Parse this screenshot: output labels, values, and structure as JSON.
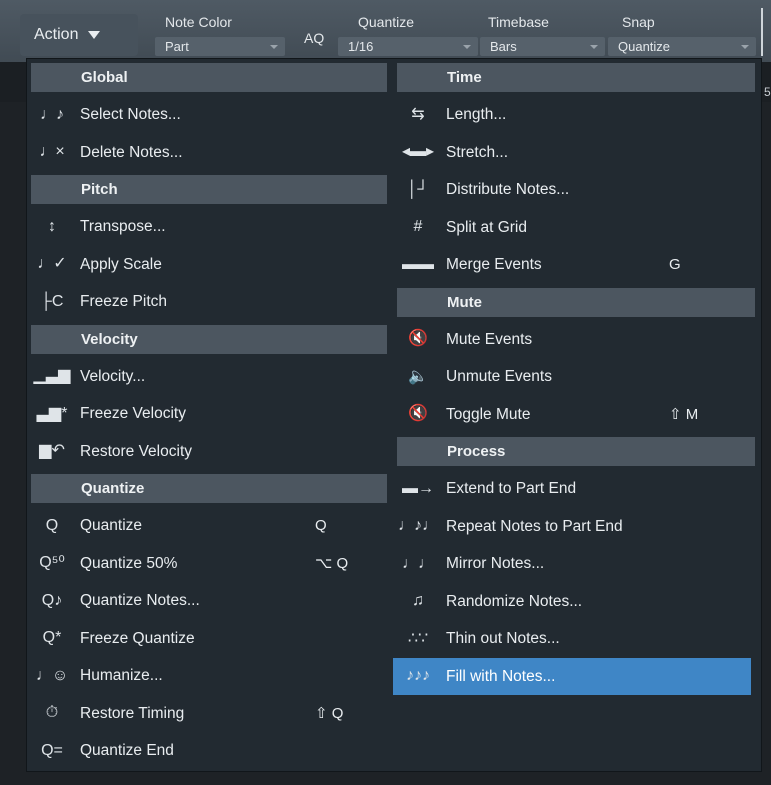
{
  "toolbar": {
    "action": "Action",
    "note_color": {
      "label": "Note Color",
      "value": "Part"
    },
    "aq": "AQ",
    "quantize": {
      "label": "Quantize",
      "value": "1/16"
    },
    "timebase": {
      "label": "Timebase",
      "value": "Bars"
    },
    "snap": {
      "label": "Snap",
      "value": "Quantize"
    }
  },
  "ruler_mark": "5",
  "menu": {
    "left": {
      "global": {
        "header": "Global",
        "items": [
          {
            "label": "Select Notes...",
            "icon": "notes-select-icon",
            "glyph": "♩♪"
          },
          {
            "label": "Delete Notes...",
            "icon": "notes-delete-icon",
            "glyph": "♩×"
          }
        ]
      },
      "pitch": {
        "header": "Pitch",
        "items": [
          {
            "label": "Transpose...",
            "icon": "transpose-icon",
            "glyph": "↕"
          },
          {
            "label": "Apply Scale",
            "icon": "apply-scale-icon",
            "glyph": "♩✓"
          },
          {
            "label": "Freeze Pitch",
            "icon": "freeze-pitch-icon",
            "glyph": "├C"
          }
        ]
      },
      "velocity": {
        "header": "Velocity",
        "items": [
          {
            "label": "Velocity...",
            "icon": "velocity-bars-icon",
            "glyph": "▁▃▆"
          },
          {
            "label": "Freeze Velocity",
            "icon": "freeze-velocity-icon",
            "glyph": "▃▆*"
          },
          {
            "label": "Restore Velocity",
            "icon": "restore-velocity-icon",
            "glyph": "▆↶"
          }
        ]
      },
      "quantize": {
        "header": "Quantize",
        "items": [
          {
            "label": "Quantize",
            "icon": "quantize-icon",
            "glyph": "Q",
            "shortcut": "Q"
          },
          {
            "label": "Quantize 50%",
            "icon": "quantize-50-icon",
            "glyph": "Q⁵⁰",
            "shortcut": "⌥ Q"
          },
          {
            "label": "Quantize Notes...",
            "icon": "quantize-notes-icon",
            "glyph": "Q♪"
          },
          {
            "label": "Freeze Quantize",
            "icon": "freeze-quantize-icon",
            "glyph": "Q*"
          },
          {
            "label": "Humanize...",
            "icon": "humanize-icon",
            "glyph": "♩☺"
          },
          {
            "label": "Restore Timing",
            "icon": "restore-timing-icon",
            "glyph": "⏱",
            "shortcut": "⇧ Q"
          },
          {
            "label": "Quantize End",
            "icon": "quantize-end-icon",
            "glyph": "Q="
          }
        ]
      }
    },
    "right": {
      "time": {
        "header": "Time",
        "items": [
          {
            "label": "Length...",
            "icon": "length-icon",
            "glyph": "⇆"
          },
          {
            "label": "Stretch...",
            "icon": "stretch-icon",
            "glyph": "◂▬▸"
          },
          {
            "label": "Distribute Notes...",
            "icon": "distribute-notes-icon",
            "glyph": "│┘"
          },
          {
            "label": "Split at Grid",
            "icon": "split-grid-icon",
            "glyph": "#"
          },
          {
            "label": "Merge Events",
            "icon": "merge-events-icon",
            "glyph": "▬▬",
            "shortcut": "G"
          }
        ]
      },
      "mute": {
        "header": "Mute",
        "items": [
          {
            "label": "Mute Events",
            "icon": "mute-speaker-icon",
            "glyph": "🔇"
          },
          {
            "label": "Unmute Events",
            "icon": "unmute-speaker-icon",
            "glyph": "🔈"
          },
          {
            "label": "Toggle Mute",
            "icon": "toggle-mute-icon",
            "glyph": "🔇",
            "shortcut": "⇧ M"
          }
        ]
      },
      "process": {
        "header": "Process",
        "items": [
          {
            "label": "Extend to Part End",
            "icon": "extend-part-end-icon",
            "glyph": "▬→"
          },
          {
            "label": "Repeat Notes to Part End",
            "icon": "repeat-notes-icon",
            "glyph": "♩♪♩"
          },
          {
            "label": "Mirror Notes...",
            "icon": "mirror-notes-icon",
            "glyph": "♩♩"
          },
          {
            "label": "Randomize Notes...",
            "icon": "randomize-notes-icon",
            "glyph": "♫"
          },
          {
            "label": "Thin out Notes...",
            "icon": "thin-out-notes-icon",
            "glyph": "∴∵"
          },
          {
            "label": "Fill with Notes...",
            "icon": "fill-notes-icon",
            "glyph": "♪♪♪"
          }
        ]
      }
    }
  },
  "highlighted_item": "Fill with Notes...",
  "colors": {
    "menu_bg": "#222a31",
    "header_bg": "#4c5660",
    "highlight": "#3f86c6",
    "toolbar": "#4a545e"
  }
}
